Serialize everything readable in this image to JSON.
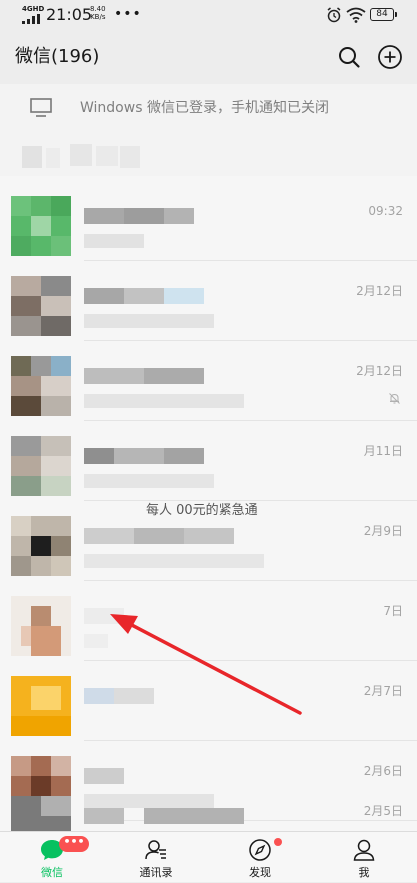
{
  "status_bar": {
    "network": "4GHD",
    "time": "21:05",
    "speed_value": "8.40",
    "speed_unit": "KB/s",
    "more": "•••",
    "battery": "84"
  },
  "header": {
    "title": "微信(196)"
  },
  "banner": {
    "text": "Windows 微信已登录，手机通知已关闭"
  },
  "chats": [
    {
      "time": "09:32",
      "muted": false
    },
    {
      "time": "2月12日",
      "muted": false
    },
    {
      "time": "2月12日",
      "muted": true
    },
    {
      "time": "月11日",
      "muted": false
    },
    {
      "time": "2月9日",
      "muted": false
    },
    {
      "time": "7日",
      "muted": false
    },
    {
      "time": "2月7日",
      "muted": false
    },
    {
      "time": "2月6日",
      "muted": false
    },
    {
      "time": "2月5日",
      "muted": false
    }
  ],
  "partial_message_text": "每人        00元的紧急通",
  "tabs": [
    {
      "label": "微信",
      "active": true,
      "badge": "•••"
    },
    {
      "label": "通讯录",
      "active": false
    },
    {
      "label": "发现",
      "active": false,
      "dot": true
    },
    {
      "label": "我",
      "active": false
    }
  ],
  "colors": {
    "accent": "#07c160",
    "badge": "#fa5151",
    "annotation_arrow": "#e8262a"
  }
}
